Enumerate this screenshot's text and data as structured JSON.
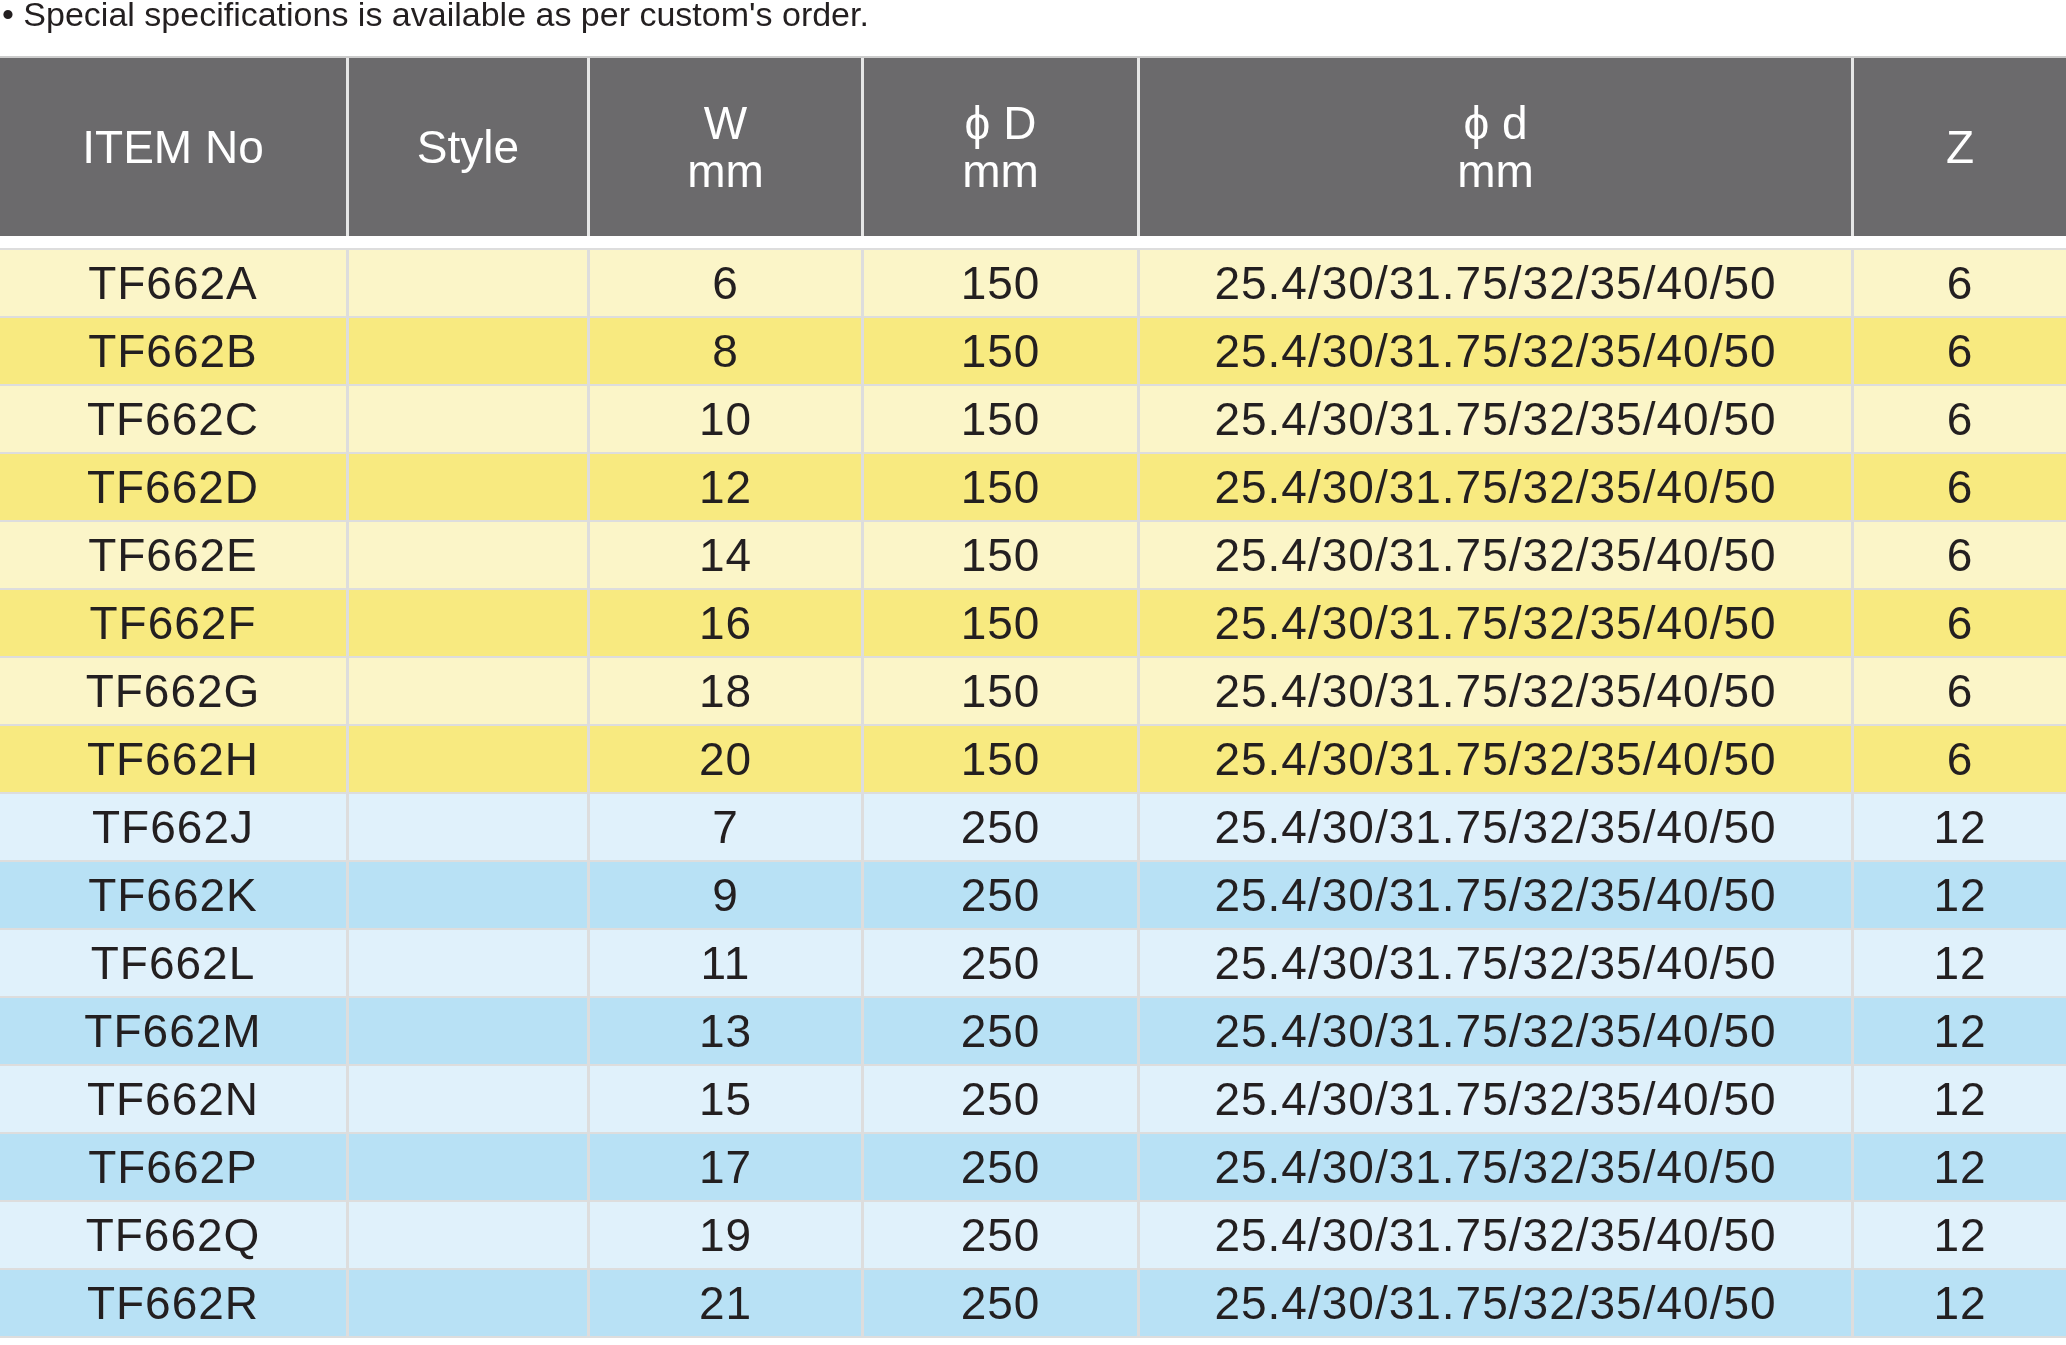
{
  "note": "• Special specifications is available as per custom's order.",
  "table": {
    "columns": [
      {
        "lines": [
          "ITEM No"
        ]
      },
      {
        "lines": [
          "Style"
        ]
      },
      {
        "lines": [
          "W",
          "mm"
        ]
      },
      {
        "lines": [
          "ϕ D",
          "mm"
        ]
      },
      {
        "lines": [
          "ϕ d",
          "mm"
        ]
      },
      {
        "lines": [
          "Z"
        ]
      }
    ],
    "rows": [
      {
        "color": "#fbf5c8",
        "cells": [
          "TF662A",
          "",
          "6",
          "150",
          "25.4/30/31.75/32/35/40/50",
          "6"
        ]
      },
      {
        "color": "#f8ea80",
        "cells": [
          "TF662B",
          "",
          "8",
          "150",
          "25.4/30/31.75/32/35/40/50",
          "6"
        ]
      },
      {
        "color": "#fbf5c8",
        "cells": [
          "TF662C",
          "",
          "10",
          "150",
          "25.4/30/31.75/32/35/40/50",
          "6"
        ]
      },
      {
        "color": "#f8ea80",
        "cells": [
          "TF662D",
          "",
          "12",
          "150",
          "25.4/30/31.75/32/35/40/50",
          "6"
        ]
      },
      {
        "color": "#fbf5c8",
        "cells": [
          "TF662E",
          "",
          "14",
          "150",
          "25.4/30/31.75/32/35/40/50",
          "6"
        ]
      },
      {
        "color": "#f8ea80",
        "cells": [
          "TF662F",
          "",
          "16",
          "150",
          "25.4/30/31.75/32/35/40/50",
          "6"
        ]
      },
      {
        "color": "#fbf5c8",
        "cells": [
          "TF662G",
          "",
          "18",
          "150",
          "25.4/30/31.75/32/35/40/50",
          "6"
        ]
      },
      {
        "color": "#f8ea80",
        "cells": [
          "TF662H",
          "",
          "20",
          "150",
          "25.4/30/31.75/32/35/40/50",
          "6"
        ]
      },
      {
        "color": "#e0f1fb",
        "cells": [
          "TF662J",
          "",
          "7",
          "250",
          "25.4/30/31.75/32/35/40/50",
          "12"
        ]
      },
      {
        "color": "#b8e1f5",
        "cells": [
          "TF662K",
          "",
          "9",
          "250",
          "25.4/30/31.75/32/35/40/50",
          "12"
        ]
      },
      {
        "color": "#e0f1fb",
        "cells": [
          "TF662L",
          "",
          "11",
          "250",
          "25.4/30/31.75/32/35/40/50",
          "12"
        ]
      },
      {
        "color": "#b8e1f5",
        "cells": [
          "TF662M",
          "",
          "13",
          "250",
          "25.4/30/31.75/32/35/40/50",
          "12"
        ]
      },
      {
        "color": "#e0f1fb",
        "cells": [
          "TF662N",
          "",
          "15",
          "250",
          "25.4/30/31.75/32/35/40/50",
          "12"
        ]
      },
      {
        "color": "#b8e1f5",
        "cells": [
          "TF662P",
          "",
          "17",
          "250",
          "25.4/30/31.75/32/35/40/50",
          "12"
        ]
      },
      {
        "color": "#e0f1fb",
        "cells": [
          "TF662Q",
          "",
          "19",
          "250",
          "25.4/30/31.75/32/35/40/50",
          "12"
        ]
      },
      {
        "color": "#b8e1f5",
        "cells": [
          "TF662R",
          "",
          "21",
          "250",
          "25.4/30/31.75/32/35/40/50",
          "12"
        ]
      }
    ]
  }
}
